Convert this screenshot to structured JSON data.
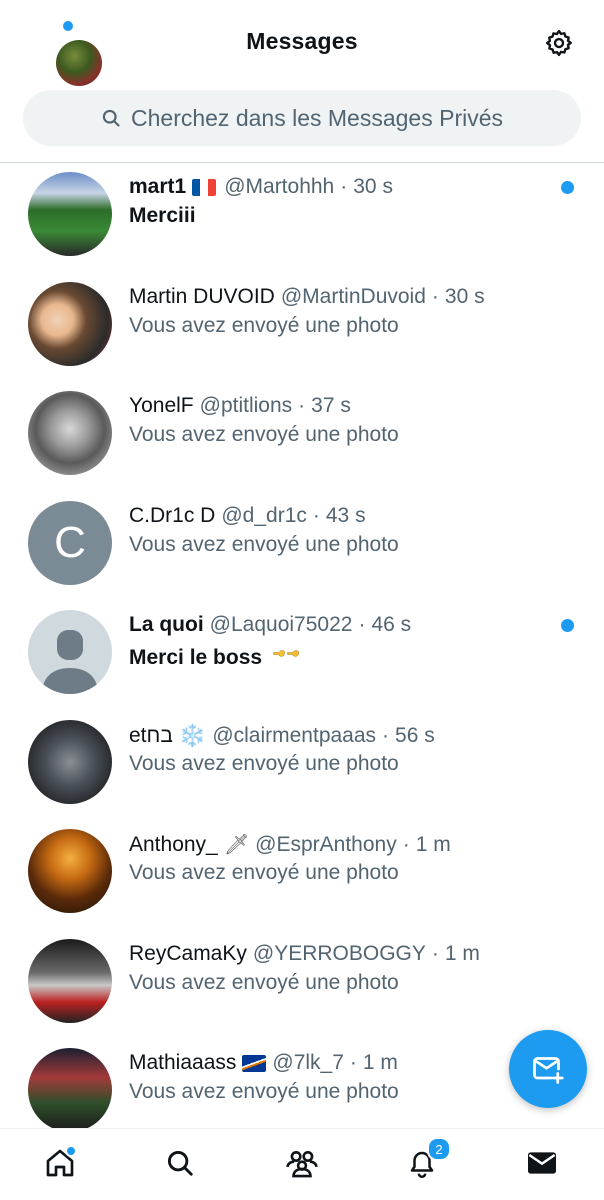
{
  "header": {
    "title": "Messages"
  },
  "search": {
    "placeholder": "Cherchez dans les Messages Privés"
  },
  "colors": {
    "accent": "#1d9bf0",
    "secondary_text": "#536471",
    "primary_text": "#0f1419"
  },
  "conversations": [
    {
      "name": "mart1",
      "badge": "flag-france",
      "handle": "@Martohhh",
      "sep": "·",
      "time": "30 s",
      "preview": "Merciii",
      "unread": true
    },
    {
      "name": "Martin DUVOID",
      "handle": "@MartinDuvoid",
      "sep": "·",
      "time": "30 s",
      "preview": "Vous avez envoyé une photo",
      "unread": false
    },
    {
      "name": "YonelF",
      "handle": "@ptitlions",
      "sep": "·",
      "time": "37 s",
      "preview": "Vous avez envoyé une photo",
      "unread": false
    },
    {
      "name": "C.Dr1c D",
      "handle": "@d_dr1c",
      "sep": "·",
      "time": "43 s",
      "preview": "Vous avez envoyé une photo",
      "unread": false,
      "avatar_letter": "C"
    },
    {
      "name": "La quoi",
      "handle": "@Laquoi75022",
      "sep": "·",
      "time": "46 s",
      "preview": "Merci le boss",
      "preview_badge": "pointing-hands-emoji",
      "unread": true
    },
    {
      "name": "etבח",
      "badge": "snowflake-emoji",
      "handle": "@clairmentpaaas",
      "sep": "·",
      "time": "56 s",
      "preview": "Vous avez envoyé une photo",
      "unread": false
    },
    {
      "name": "Anthony_",
      "badge": "dagger-emoji",
      "handle": "@EsprAnthony",
      "sep": "·",
      "time": "1 m",
      "preview": "Vous avez envoyé une photo",
      "unread": false
    },
    {
      "name": "ReyCamaKy",
      "handle": "@YERROBOGGY",
      "sep": "·",
      "time": "1 m",
      "preview": "Vous avez envoyé une photo",
      "unread": false
    },
    {
      "name": "Mathiaaass",
      "badge": "flag-marshall-islands",
      "handle": "@7lk_7",
      "sep": "·",
      "time": "1 m",
      "preview": "Vous avez envoyé une photo",
      "unread": false
    }
  ],
  "icons": {
    "snowflake": "❄️",
    "dagger": "🗡"
  },
  "bottom_nav": {
    "items": [
      "home-icon",
      "search-icon",
      "communities-icon",
      "notifications-icon",
      "messages-icon"
    ],
    "notifications_count": "2"
  },
  "fab": {
    "icon": "new-message-icon"
  }
}
